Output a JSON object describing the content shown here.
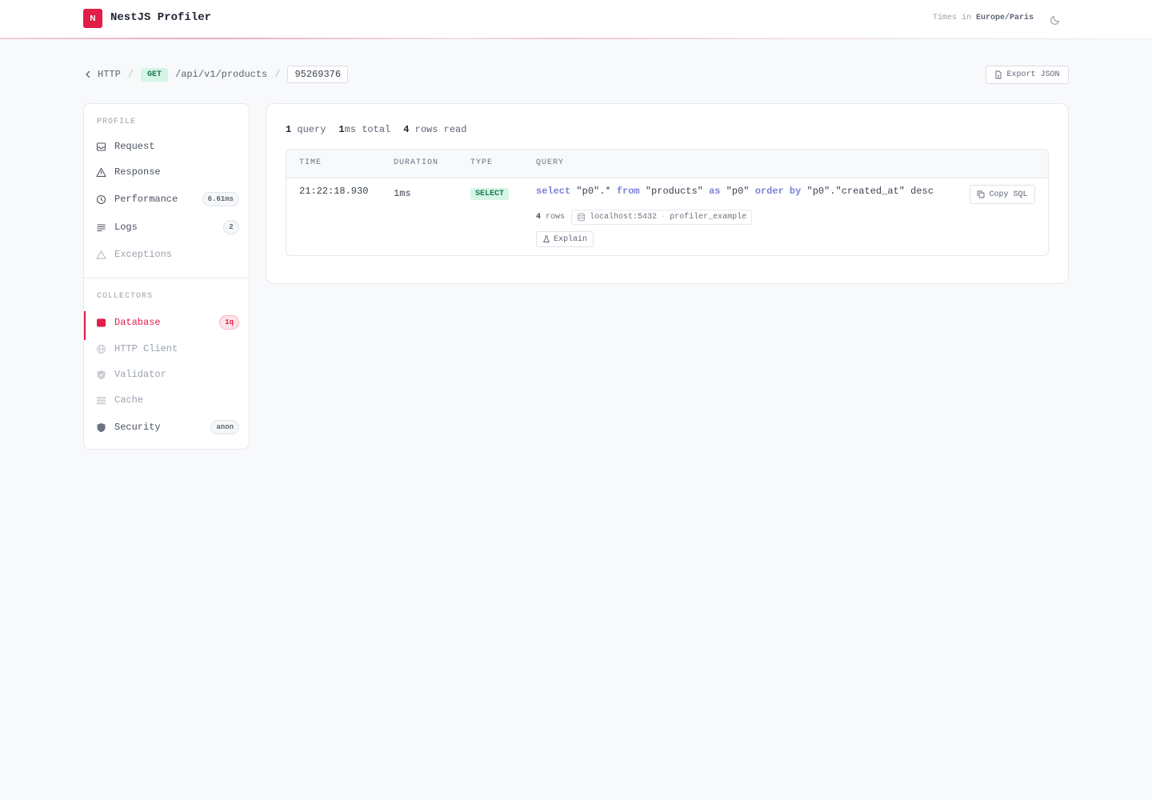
{
  "header": {
    "logo_letter": "N",
    "title": "NestJS Profiler",
    "timezone_prefix": "Times in",
    "timezone": "Europe/Paris",
    "theme_toggle_icon": "moon-icon"
  },
  "breadcrumb": {
    "back_label": "HTTP",
    "separator": "/",
    "method": "GET",
    "path": "/api/v1/products",
    "profile_id": "95269376"
  },
  "toolbar": {
    "export_label": "Export JSON"
  },
  "sidebar": {
    "profile_heading": "PROFILE",
    "profile_items": [
      {
        "label": "Request",
        "icon": "inbox-icon"
      },
      {
        "label": "Response",
        "icon": "triangle-icon"
      },
      {
        "label": "Performance",
        "icon": "clock-icon",
        "badge": "6.61ms"
      },
      {
        "label": "Logs",
        "icon": "lines-icon",
        "badge": "2"
      },
      {
        "label": "Exceptions",
        "icon": "warning-icon"
      }
    ],
    "collectors_heading": "COLLECTORS",
    "collector_items": [
      {
        "label": "Database",
        "icon": "database-icon",
        "badge": "1q",
        "active": true
      },
      {
        "label": "HTTP Client",
        "icon": "globe-icon"
      },
      {
        "label": "Validator",
        "icon": "shield-check-icon"
      },
      {
        "label": "Cache",
        "icon": "cache-icon"
      },
      {
        "label": "Security",
        "icon": "shield-icon",
        "badge": "anon"
      }
    ]
  },
  "stats": {
    "query_count": "1",
    "query_label": "query",
    "total_ms": "1",
    "total_label": "ms total",
    "rows_read": "4",
    "rows_label": "rows read"
  },
  "table": {
    "headers": [
      "TIME",
      "DURATION",
      "TYPE",
      "QUERY"
    ],
    "rows": [
      {
        "time": "21:22:18.930",
        "duration": "1ms",
        "type": "SELECT",
        "sql": {
          "k1": "select",
          "t1": " \"p0\".* ",
          "k2": "from",
          "t2": " \"products\" ",
          "k3": "as",
          "t3": " \"p0\" ",
          "k4": "order by",
          "t4": " \"p0\".\"created_at\" desc"
        },
        "rows_count": "4",
        "rows_label": "rows",
        "host": "localhost:5432",
        "database": "profiler_example",
        "explain_label": "Explain",
        "copy_label": "Copy SQL"
      }
    ]
  },
  "colors": {
    "accent": "#e11d48",
    "get_badge_bg": "#d5f5e6",
    "sql_keyword": "#7c83d6"
  }
}
